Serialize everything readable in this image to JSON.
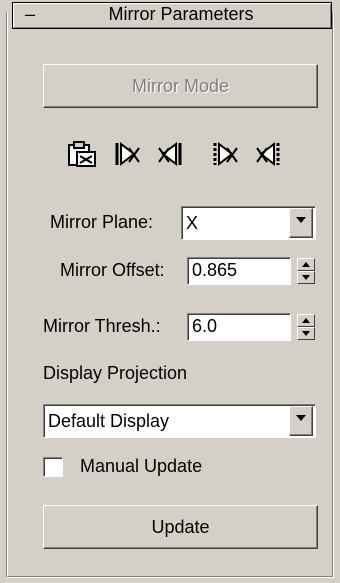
{
  "rollout": {
    "collapse": "–",
    "title": "Mirror Parameters"
  },
  "mirror_mode": {
    "label": "Mirror Mode"
  },
  "icons": [
    "paste-clipboard-icon",
    "mirror-right-icon",
    "mirror-left-icon",
    "mirror-selected-right-icon",
    "mirror-selected-left-icon"
  ],
  "mirror_plane": {
    "label": "Mirror Plane:",
    "value": "X"
  },
  "mirror_offset": {
    "label": "Mirror Offset:",
    "value": "0.865"
  },
  "mirror_thresh": {
    "label": "Mirror Thresh.:",
    "value": "6.0"
  },
  "display_projection": {
    "label": "Display Projection",
    "value": "Default Display"
  },
  "manual_update": {
    "label": "Manual Update",
    "checked": false
  },
  "update": {
    "label": "Update"
  }
}
